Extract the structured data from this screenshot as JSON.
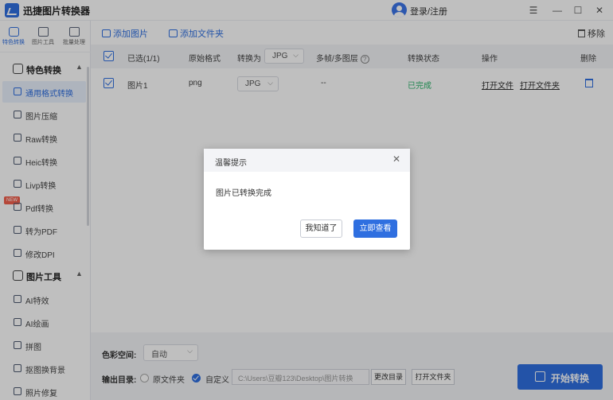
{
  "app": {
    "title": "迅捷图片转换器",
    "login": "登录/注册",
    "window": {
      "menu": "☰",
      "minimize": "—",
      "maximize": "☐",
      "close": "✕"
    }
  },
  "rail": {
    "tabs": [
      {
        "label": "特色转换",
        "active": true
      },
      {
        "label": "图片工具",
        "active": false
      },
      {
        "label": "批量处理",
        "active": false
      }
    ],
    "sections": [
      {
        "label": "特色转换",
        "items": [
          {
            "label": "通用格式转换",
            "active": true
          },
          {
            "label": "图片压缩"
          },
          {
            "label": "Raw转换"
          },
          {
            "label": "Heic转换"
          },
          {
            "label": "Livp转换"
          },
          {
            "label": "Pdf转换",
            "badge": "NEW"
          },
          {
            "label": "转为PDF"
          },
          {
            "label": "修改DPI"
          }
        ]
      },
      {
        "label": "图片工具",
        "items": [
          {
            "label": "AI特效"
          },
          {
            "label": "AI绘画"
          },
          {
            "label": "拼图"
          },
          {
            "label": "抠图换背景"
          },
          {
            "label": "照片修复"
          }
        ]
      }
    ]
  },
  "toolbar": {
    "add_image": "添加图片",
    "add_folder": "添加文件夹",
    "remove": "移除"
  },
  "table": {
    "headers": {
      "selected": "已选(1/1)",
      "original_format": "原始格式",
      "convert_to": "转换为",
      "convert_to_value": "JPG",
      "frames": "多帧/多图层",
      "status": "转换状态",
      "actions": "操作",
      "delete": "删除"
    },
    "rows": [
      {
        "name": "图片1",
        "format": "png",
        "target": "JPG",
        "frames": "--",
        "status": "已完成",
        "open_file": "打开文件",
        "open_folder": "打开文件夹"
      }
    ]
  },
  "modal": {
    "title": "温馨提示",
    "message": "图片已转换完成",
    "close": "✕",
    "dismiss": "我知道了",
    "view": "立即查看"
  },
  "bottom": {
    "color_space_label": "色彩空间:",
    "color_space_value": "自动",
    "output_label": "输出目录:",
    "option_original": "原文件夹",
    "option_custom": "自定义",
    "path": "C:\\Users\\豆瓣123\\Desktop\\图片转换",
    "change_dir": "更改目录",
    "open_folder": "打开文件夹",
    "start": "开始转换"
  },
  "colors": {
    "accent": "#2f6fe0",
    "success": "#2bb36a",
    "badge": "#f25f4c"
  }
}
